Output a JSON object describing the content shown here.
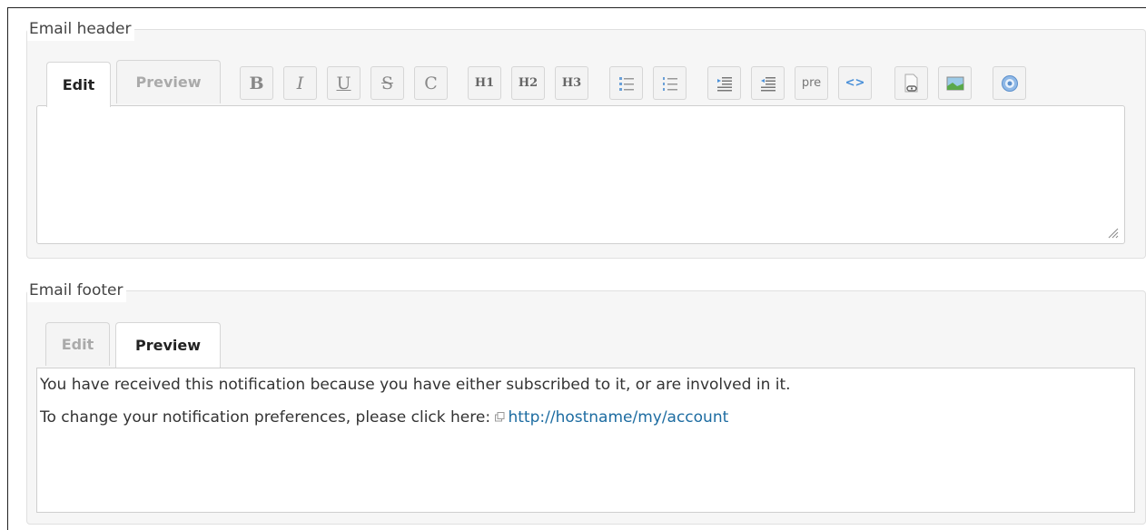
{
  "header_section": {
    "legend": "Email header",
    "tabs": {
      "edit": "Edit",
      "preview": "Preview",
      "active": "edit"
    },
    "toolbar": {
      "bold": "B",
      "italic": "I",
      "underline": "U",
      "strike": "S",
      "code": "C",
      "h1": "H1",
      "h2": "H2",
      "h3": "H3",
      "pre": "pre",
      "code_tag": "<>"
    },
    "textarea_value": ""
  },
  "footer_section": {
    "legend": "Email footer",
    "tabs": {
      "edit": "Edit",
      "preview": "Preview",
      "active": "preview"
    },
    "preview_line1": "You have received this notification because you have either subscribed to it, or are involved in it.",
    "preview_line2_prefix": "To change your notification preferences, please click here:",
    "preview_link": "http://hostname/my/account"
  },
  "colors": {
    "link": "#1d6ca1",
    "fieldset_bg": "#f6f6f6"
  },
  "icons": [
    "unordered-list-icon",
    "ordered-list-icon",
    "indent-icon",
    "outdent-icon",
    "link-icon",
    "image-icon",
    "help-icon",
    "external-link-icon",
    "resize-grip-icon"
  ]
}
